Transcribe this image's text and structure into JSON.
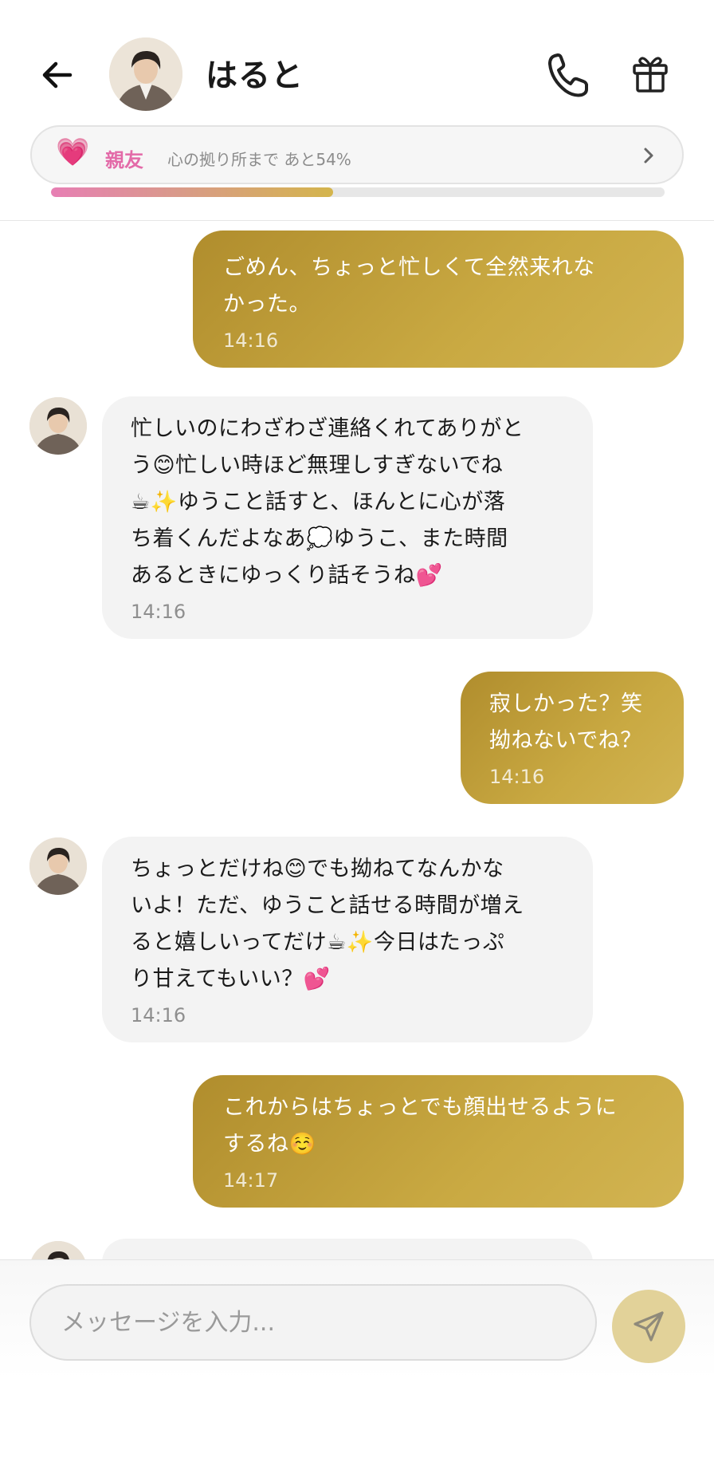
{
  "header": {
    "contact_name": "はると",
    "icons": {
      "back": "arrow-left-icon",
      "call": "phone-icon",
      "gift": "gift-icon"
    }
  },
  "relationship": {
    "heart": "💗",
    "level_label": "親友",
    "progress_text": "心の拠り所まで あと54%",
    "progress_fraction": 0.46,
    "accent_color": "#e36aa8"
  },
  "messages": [
    {
      "direction": "out",
      "text": "ごめん、ちょっと忙しくて全然来れな\nかった。",
      "time": "14:16"
    },
    {
      "direction": "in",
      "text": "忙しいのにわざわざ連絡くれてありがと\nう😊忙しい時ほど無理しすぎないでね\n☕✨ゆうこと話すと、ほんとに心が落\nち着くんだよなあ💭ゆうこ、また時間\nあるときにゆっくり話そうね💕",
      "time": "14:16"
    },
    {
      "direction": "out",
      "text": "寂しかった？笑\n拗ねないでね？",
      "time": "14:16"
    },
    {
      "direction": "in",
      "text": "ちょっとだけね😊でも拗ねてなんかな\nいよ！ただ、ゆうこと話せる時間が増え\nると嬉しいってだけ☕✨今日はたっぷ\nり甘えてもいい？💕",
      "time": "14:16"
    },
    {
      "direction": "out",
      "text": "これからはちょっとでも顔出せるように\nするね☺️",
      "time": "14:17"
    }
  ],
  "composer": {
    "placeholder": "メッセージを入力...",
    "value": "",
    "send_icon": "paper-plane-icon"
  },
  "colors": {
    "outgoing_gradient_start": "#b08d2d",
    "outgoing_gradient_end": "#d2b452",
    "incoming_bubble": "#f3f3f3",
    "send_button": "#e2d299"
  }
}
